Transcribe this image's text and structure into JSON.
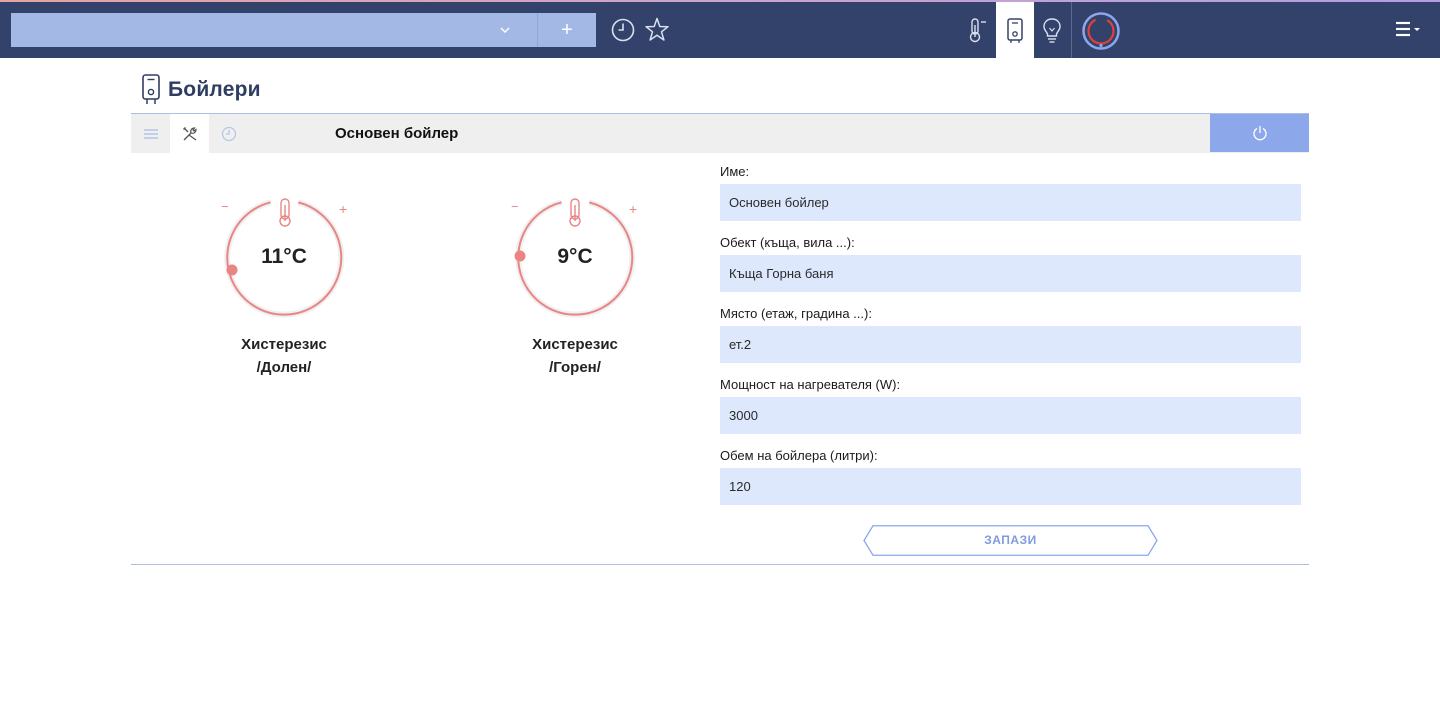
{
  "topbar": {
    "selector_value": "",
    "add_label": "+",
    "nav": [
      {
        "name": "thermostats",
        "icon": "thermometer-icon",
        "active": false
      },
      {
        "name": "boilers",
        "icon": "boiler-icon",
        "active": true
      },
      {
        "name": "lights",
        "icon": "bulb-icon",
        "active": false
      }
    ]
  },
  "page": {
    "title": "Бойлери",
    "icon": "boiler-icon"
  },
  "panel": {
    "title": "Основен бойлер",
    "tabs": [
      "list-icon",
      "settings-icon",
      "clock-icon"
    ],
    "active_tab": "settings-icon",
    "power_icon": "power-icon"
  },
  "dials": [
    {
      "value": "11°C",
      "caption_line1": "Хистерезис",
      "caption_line2": "/Долен/",
      "minus": "−",
      "plus": "+"
    },
    {
      "value": "9°C",
      "caption_line1": "Хистерезис",
      "caption_line2": "/Горен/",
      "minus": "−",
      "plus": "+"
    }
  ],
  "form": {
    "fields": [
      {
        "label": "Име:",
        "value": "Основен бойлер"
      },
      {
        "label": "Обект (къща, вила ...):",
        "value": "Къща Горна баня"
      },
      {
        "label": "Място (етаж, градина ...):",
        "value": "ет.2"
      },
      {
        "label": "Мощност на нагревателя (W):",
        "value": "3000"
      },
      {
        "label": "Обем на бойлера (литри):",
        "value": "120"
      }
    ],
    "save_label": "ЗАПАЗИ"
  },
  "colors": {
    "topbar": "#33426b",
    "accent_blue": "#8ca8eb",
    "input_bg": "#dde8fd",
    "dial_red": "#e98585"
  }
}
